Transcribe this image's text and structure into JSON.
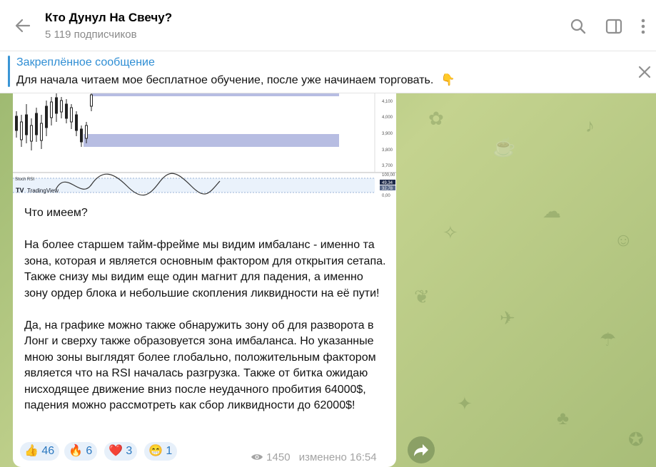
{
  "header": {
    "title": "Кто Дунул На Свечу?",
    "subscribers": "5 119 подписчиков",
    "icons": [
      "back-arrow-icon",
      "search-icon",
      "sidebar-toggle-icon",
      "more-vertical-icon"
    ]
  },
  "pinned": {
    "title": "Закреплённое сообщение",
    "text": "Для начала читаем мое бесплатное обучение, после уже начинаем торговать.",
    "emoji": "👇"
  },
  "chart": {
    "price_ticks": [
      "4,100",
      "4,000",
      "3,900",
      "3,800",
      "3,700"
    ],
    "indicator_label": "Stoch RSI",
    "indicator_ticks": [
      "100,00",
      "0,00"
    ],
    "indicator_badges": [
      "49,34",
      "32,78"
    ],
    "watermark": "TradingView"
  },
  "message": {
    "paragraphs": [
      "Что имеем?",
      "На более старшем тайм-фрейме мы видим имбаланс - именно та зона, которая и является основным фактором для открытия сетапа. Также снизу мы видим еще один магнит для падения, а именно зону ордер блока и небольшие скопления ликвидности на её пути!",
      "Да, на графике можно также обнаружить зону об для разворота в Лонг и сверху также образовуется зона имбаланса. Но указанные мною зоны выглядят более глобально, положительным фактором является что на RSI началась разгрузка. Также от битка ожидаю нисходящее движение вниз после неудачного пробития 64000$, падения можно рассмотреть как сбор ликвидности до 62000$!"
    ],
    "reactions": [
      {
        "emoji": "👍",
        "count": "46"
      },
      {
        "emoji": "🔥",
        "count": "6"
      },
      {
        "emoji": "❤️",
        "count": "3"
      },
      {
        "emoji": "😁",
        "count": "1"
      }
    ],
    "views": "1450",
    "edited": "изменено 16:54"
  },
  "colors": {
    "accent": "#2f8ed4",
    "zone": "#b7bde2",
    "reaction_bg": "#e7f0fa"
  }
}
